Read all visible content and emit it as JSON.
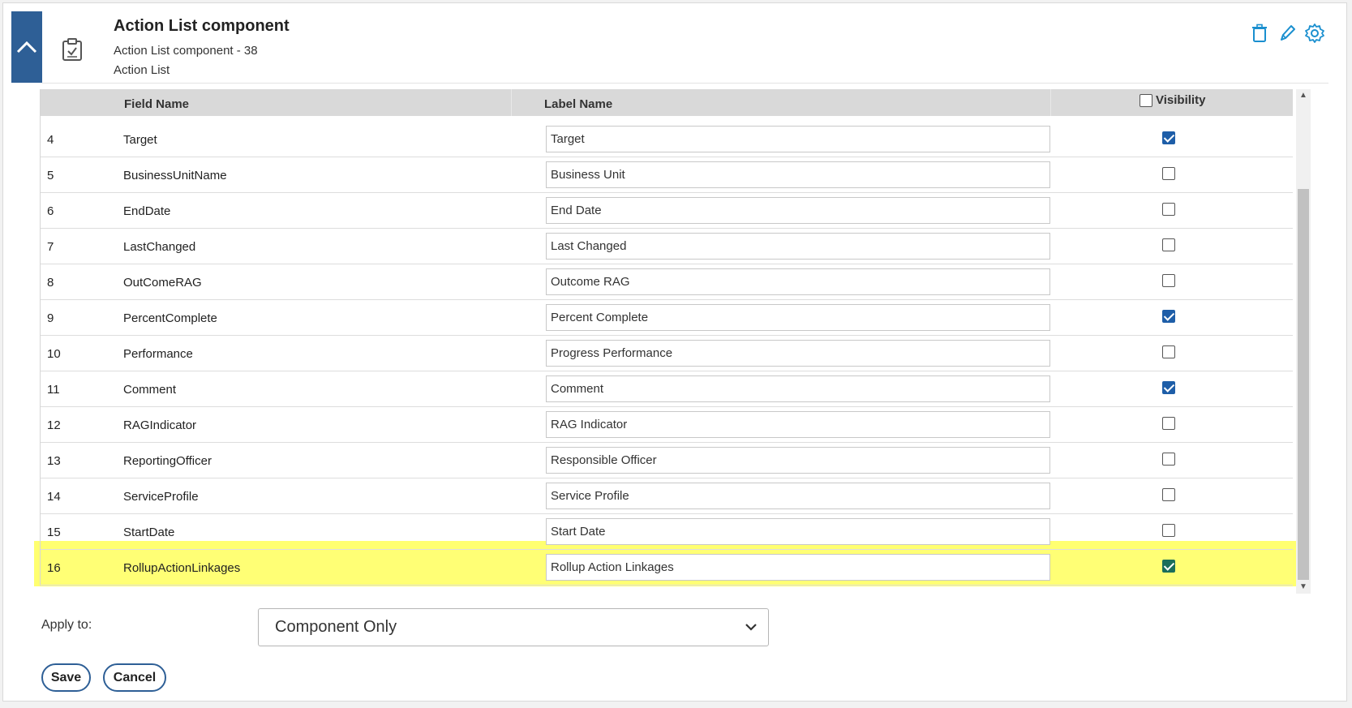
{
  "header": {
    "title": "Action List component",
    "subtitle": "Action List component - 38",
    "type": "Action List",
    "icon": "clipboard-check-icon"
  },
  "toolbar": {
    "icons": [
      "trash-icon",
      "pencil-icon",
      "gear-icon"
    ],
    "accent": "#1a8fcf"
  },
  "grid": {
    "columns": {
      "field_name": "Field Name",
      "label_name": "Label Name",
      "visibility": "Visibility"
    },
    "visibility_all_checked": false,
    "rows": [
      {
        "num": "4",
        "field": "Target",
        "label": "Target",
        "visible": true
      },
      {
        "num": "5",
        "field": "BusinessUnitName",
        "label": "Business Unit",
        "visible": false
      },
      {
        "num": "6",
        "field": "EndDate",
        "label": "End Date",
        "visible": false
      },
      {
        "num": "7",
        "field": "LastChanged",
        "label": "Last Changed",
        "visible": false
      },
      {
        "num": "8",
        "field": "OutComeRAG",
        "label": "Outcome RAG",
        "visible": false
      },
      {
        "num": "9",
        "field": "PercentComplete",
        "label": "Percent Complete",
        "visible": true
      },
      {
        "num": "10",
        "field": "Performance",
        "label": "Progress Performance",
        "visible": false
      },
      {
        "num": "11",
        "field": "Comment",
        "label": "Comment",
        "visible": true
      },
      {
        "num": "12",
        "field": "RAGIndicator",
        "label": "RAG Indicator",
        "visible": false
      },
      {
        "num": "13",
        "field": "ReportingOfficer",
        "label": "Responsible Officer",
        "visible": false
      },
      {
        "num": "14",
        "field": "ServiceProfile",
        "label": "Service Profile",
        "visible": false
      },
      {
        "num": "15",
        "field": "StartDate",
        "label": "Start Date",
        "visible": false
      },
      {
        "num": "16",
        "field": "RollupActionLinkages",
        "label": "Rollup Action Linkages",
        "visible": true,
        "highlighted": true
      }
    ]
  },
  "apply": {
    "label": "Apply to:",
    "selected": "Component Only"
  },
  "buttons": {
    "save": "Save",
    "cancel": "Cancel"
  },
  "colors": {
    "brand": "#2e5f96",
    "highlight": "#ffff75",
    "checkbox": "#1e5ea8"
  }
}
